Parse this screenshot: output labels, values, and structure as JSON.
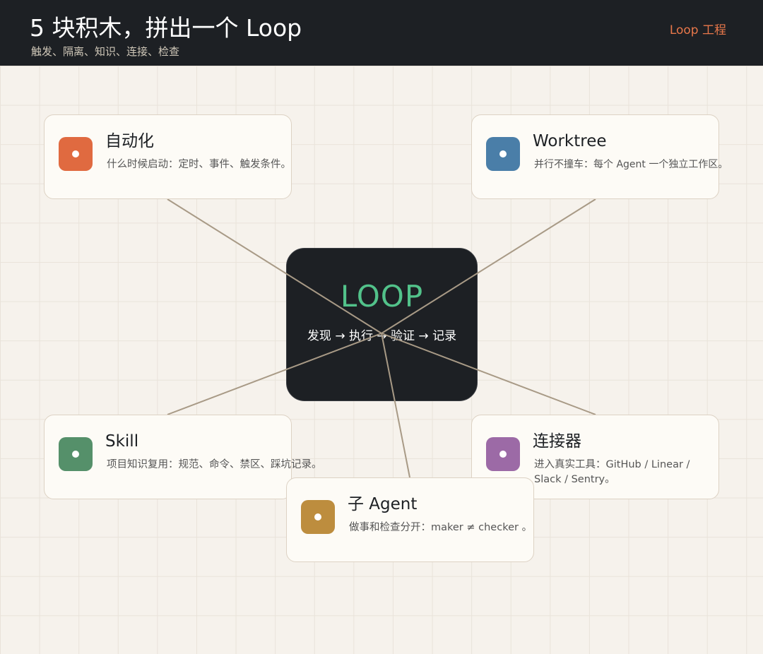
{
  "header": {
    "title": "5 块积木，拼出一个 Loop",
    "subtitle": "触发、隔离、知识、连接、检查",
    "link": "Loop 工程"
  },
  "center": {
    "title": "LOOP",
    "flow": "发现 → 执行 → 验证 → 记录"
  },
  "cards": {
    "automation": {
      "title": "自动化",
      "desc": "什么时候启动：定时、事件、触发条件。",
      "color": "#e06a40",
      "icon": "automation-icon"
    },
    "worktree": {
      "title": "Worktree",
      "desc": "并行不撞车：每个 Agent 一个独立工作区。",
      "color": "#4a7ea8",
      "icon": "worktree-icon"
    },
    "skill": {
      "title": "Skill",
      "desc": "项目知识复用：规范、命令、禁区、踩坑记录。",
      "color": "#55906a",
      "icon": "skill-icon"
    },
    "connector": {
      "title": "连接器",
      "desc": "进入真实工具：GitHub / Linear / Slack / Sentry。",
      "color": "#9c6aa6",
      "icon": "connector-icon"
    },
    "subagent": {
      "title": "子 Agent",
      "desc": "做事和检查分开：maker ≠ checker 。",
      "color": "#bd8d3e",
      "icon": "sub-agent-icon"
    }
  },
  "colors": {
    "line": "#a89a86",
    "dark": "#1d2024",
    "accent_green": "#52c28a",
    "accent_orange": "#e8774a"
  }
}
